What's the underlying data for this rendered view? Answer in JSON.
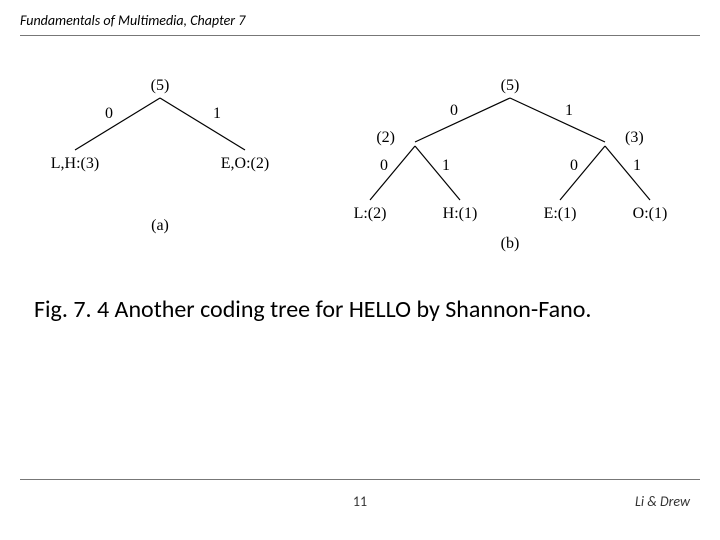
{
  "header": {
    "title": "Fundamentals of Multimedia, Chapter 7"
  },
  "caption": "Fig. 7. 4 Another coding tree for HELLO by Shannon-Fano.",
  "page_number": "11",
  "authors": "Li & Drew",
  "chart_data": [
    {
      "type": "tree",
      "label": "(a)",
      "root": {
        "count": "(5)"
      },
      "edges": [
        {
          "from": "root",
          "to": "LH",
          "bit": "0"
        },
        {
          "from": "root",
          "to": "EO",
          "bit": "1"
        }
      ],
      "leaves": [
        {
          "id": "LH",
          "text": "L,H:(3)"
        },
        {
          "id": "EO",
          "text": "E,O:(2)"
        }
      ]
    },
    {
      "type": "tree",
      "label": "(b)",
      "root": {
        "count": "(5)"
      },
      "internal": [
        {
          "id": "left",
          "count": "(2)",
          "bit_from_root": "0"
        },
        {
          "id": "right",
          "count": "(3)",
          "bit_from_root": "1"
        }
      ],
      "edges": [
        {
          "from": "left",
          "to": "L",
          "bit": "0"
        },
        {
          "from": "left",
          "to": "H",
          "bit": "1"
        },
        {
          "from": "right",
          "to": "E",
          "bit": "0"
        },
        {
          "from": "right",
          "to": "O",
          "bit": "1"
        }
      ],
      "leaves": [
        {
          "id": "L",
          "text": "L:(2)"
        },
        {
          "id": "H",
          "text": "H:(1)"
        },
        {
          "id": "E",
          "text": "E:(1)"
        },
        {
          "id": "O",
          "text": "O:(1)"
        }
      ]
    }
  ]
}
